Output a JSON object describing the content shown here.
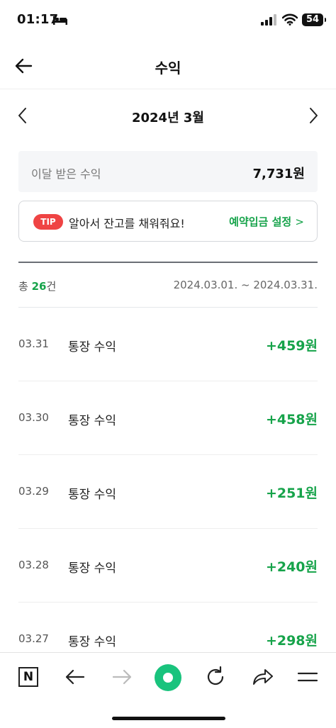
{
  "status_bar": {
    "time": "01:17",
    "battery": "54"
  },
  "header": {
    "title": "수익"
  },
  "month_nav": {
    "label": "2024년 3월"
  },
  "summary": {
    "label": "이달 받은 수익",
    "value": "7,731원"
  },
  "tip": {
    "badge": "TIP",
    "text": "알아서 잔고를 채워줘요!",
    "link": "예약입금 설정",
    "link_chevron": ">"
  },
  "list_header": {
    "count_prefix": "총 ",
    "count": "26",
    "count_suffix": "건",
    "date_range": "2024.03.01. ~ 2024.03.31."
  },
  "transactions": [
    {
      "date": "03.31",
      "name": "통장 수익",
      "amount": "+459원"
    },
    {
      "date": "03.30",
      "name": "통장 수익",
      "amount": "+458원"
    },
    {
      "date": "03.29",
      "name": "통장 수익",
      "amount": "+251원"
    },
    {
      "date": "03.28",
      "name": "통장 수익",
      "amount": "+240원"
    },
    {
      "date": "03.27",
      "name": "통장 수익",
      "amount": "+298원"
    }
  ],
  "bottom_bar": {
    "n_label": "N"
  },
  "colors": {
    "accent": "#16a34a",
    "tip_badge": "#ef4444",
    "home_button": "#19c37d"
  },
  "icons": [
    "bed-icon",
    "signal-icon",
    "wifi-icon",
    "battery-icon",
    "back-arrow-icon",
    "chevron-left-icon",
    "chevron-right-icon",
    "forward-arrow-icon",
    "reload-icon",
    "share-icon",
    "menu-icon"
  ]
}
